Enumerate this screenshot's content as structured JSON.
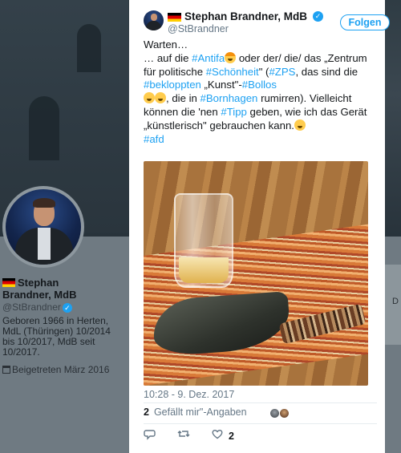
{
  "background_profile": {
    "name_line1": "Stephan",
    "name_line2": "Brandner, MdB",
    "handle": "@StBrandner",
    "bio": "Geboren 1966 in Herten, MdL (Thüringen) 10/2014 bis 10/2017, MdB seit 10/2017.",
    "joined": "Beigetreten März 2016",
    "right_fragment": "D"
  },
  "tweet": {
    "author_name": "Stephan Brandner, MdB",
    "author_handle": "@StBrandner",
    "follow_label": "Folgen",
    "text": {
      "line_warten": "Warten…",
      "p1": "… auf die ",
      "tag_antifa": "#Antifa",
      "p2": " oder der/ die/ das „Zentrum für politische ",
      "tag_schoenheit": "#Schönheit",
      "p3": "\" (",
      "tag_zps": "#ZPS",
      "p4": ", das sind die ",
      "tag_bekloppten": "#bekloppten",
      "p5": " „Kunst\"-",
      "tag_bollos": "#Bollos",
      "p6": ", die in ",
      "tag_bornhagen": "#Bornhagen",
      "p7": " rumirren). Vielleicht können die 'nen ",
      "tag_tipp": "#Tipp",
      "p8": " geben, wie ich das Gerät „künstlerisch\" gebrauchen kann.",
      "tag_afd": "#afd"
    },
    "timestamp": "10:28 - 9. Dez. 2017",
    "likes_count": "2",
    "likes_label": "Gefällt mir\"-Angaben",
    "action_like_count": "2"
  },
  "colors": {
    "link": "#1da1f2",
    "muted": "#657786"
  },
  "icons": [
    "verified-badge-icon",
    "reply-icon",
    "retweet-icon",
    "like-heart-icon",
    "calendar-icon"
  ]
}
